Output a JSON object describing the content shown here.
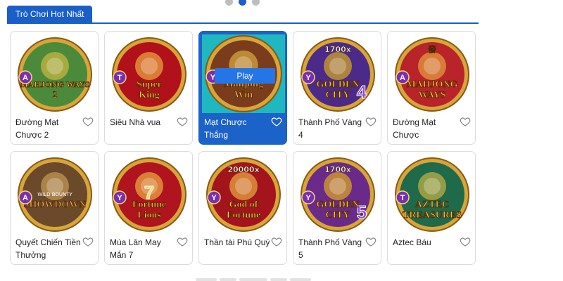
{
  "carousel": {
    "dots": 3,
    "active": 1
  },
  "section": {
    "tab_label": "Trò Chơi Hot Nhất"
  },
  "games": [
    {
      "name": "Đường Mạt Chược 2",
      "art_text": "MAHJONG WAYS 2",
      "badge": "A",
      "bg": "#4a8a3a",
      "accent": "#f4c542",
      "hover": false
    },
    {
      "name": "Siêu Nhà vua",
      "art_text": "Super King",
      "badge": "T",
      "bg": "#b0111b",
      "accent": "#ffd54a",
      "hover": false
    },
    {
      "name": "Mạt Chược Thắng",
      "art_text": "Mahjong Win",
      "badge": "Y",
      "bg": "#7a3c1c",
      "accent": "#f2c84b",
      "hover": true,
      "play_label": "Play"
    },
    {
      "name": "Thành Phố Vàng 4",
      "art_text": "GOLDEN CITY",
      "badge": "Y",
      "bg": "#4b2a8a",
      "accent": "#ffcc00",
      "top_text": "1700x",
      "num": "4",
      "hover": false
    },
    {
      "name": "Đường Mạt Chược",
      "art_text": "MAHJONG WAYS",
      "badge": "A",
      "bg": "#b9232a",
      "accent": "#f4c542",
      "top_text": "發",
      "hover": false
    },
    {
      "name": "Quyết Chiến Tiền Thưởng",
      "art_text": "SHOWDOWN",
      "sub_text": "WILD BOUNTY",
      "badge": "A",
      "bg": "#6a4a2a",
      "accent": "#e0b060",
      "hover": false
    },
    {
      "name": "Múa Lân May Mắn 7",
      "art_text": "Fortune Lions",
      "badge": "Y",
      "bg": "#b0141e",
      "accent": "#ffd54a",
      "num": "7",
      "hover": false
    },
    {
      "name": "Thần tài Phú Quý",
      "art_text": "God of Fortune",
      "badge": "Y",
      "bg": "#a3141c",
      "accent": "#ffd54a",
      "top_text": "20000x",
      "hover": false
    },
    {
      "name": "Thành Phố Vàng 5",
      "art_text": "GOLDEN CITY",
      "badge": "Y",
      "bg": "#6a2a8a",
      "accent": "#ffcc00",
      "top_text": "1700x",
      "num": "5",
      "hover": false
    },
    {
      "name": "Aztec Báu",
      "art_text": "AZTEC TREASURES",
      "badge": "T",
      "bg": "#1f6a4a",
      "accent": "#f4c542",
      "hover": false
    }
  ],
  "pagination": {
    "items": 5
  }
}
